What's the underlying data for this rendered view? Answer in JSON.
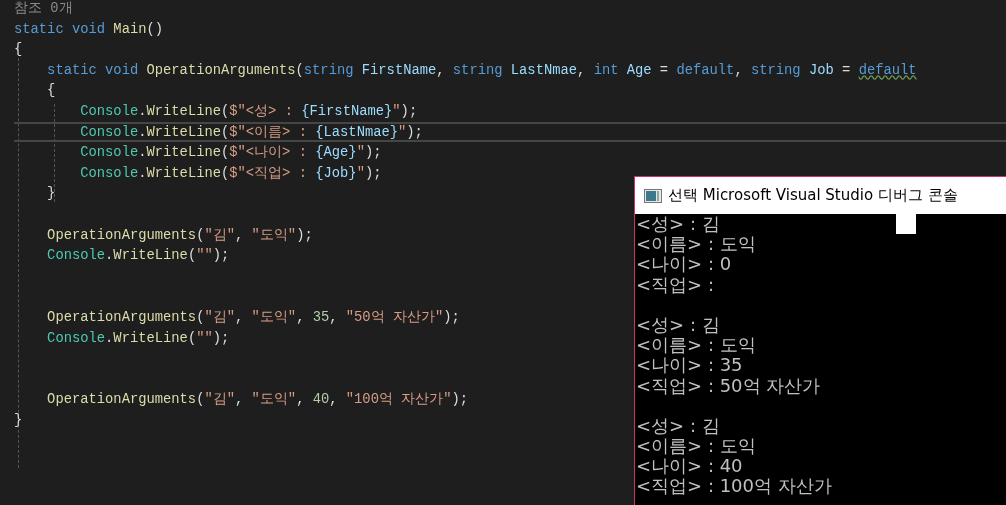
{
  "editor": {
    "lines": [
      {
        "current": false,
        "tokens": [
          {
            "kind": "comment",
            "text": "참조 0개"
          }
        ]
      },
      {
        "current": false,
        "tokens": [
          {
            "kind": "keyword",
            "text": "static void "
          },
          {
            "kind": "method",
            "text": "Main"
          },
          {
            "kind": "plain",
            "text": "()"
          }
        ]
      },
      {
        "current": false,
        "tokens": [
          {
            "kind": "plain",
            "text": "{"
          }
        ]
      },
      {
        "current": false,
        "tokens": [
          {
            "kind": "keyword",
            "text": "    static void "
          },
          {
            "kind": "method",
            "text": "OperationArguments"
          },
          {
            "kind": "plain",
            "text": "("
          },
          {
            "kind": "keyword",
            "text": "string "
          },
          {
            "kind": "param",
            "text": "FirstName"
          },
          {
            "kind": "plain",
            "text": ", "
          },
          {
            "kind": "keyword",
            "text": "string "
          },
          {
            "kind": "param",
            "text": "LastNmae"
          },
          {
            "kind": "plain",
            "text": ", "
          },
          {
            "kind": "keyword",
            "text": "int "
          },
          {
            "kind": "param",
            "text": "Age"
          },
          {
            "kind": "plain",
            "text": " = "
          },
          {
            "kind": "keyword",
            "text": "default"
          },
          {
            "kind": "plain",
            "text": ", "
          },
          {
            "kind": "keyword",
            "text": "string "
          },
          {
            "kind": "param",
            "text": "Job"
          },
          {
            "kind": "plain",
            "text": " = "
          },
          {
            "kind": "keyword",
            "text": "default",
            "squiggle": true
          }
        ]
      },
      {
        "current": false,
        "tokens": [
          {
            "kind": "plain",
            "text": "    {"
          }
        ]
      },
      {
        "current": false,
        "tokens": [
          {
            "kind": "type",
            "text": "        Console"
          },
          {
            "kind": "plain",
            "text": "."
          },
          {
            "kind": "method",
            "text": "WriteLine"
          },
          {
            "kind": "plain",
            "text": "("
          },
          {
            "kind": "string",
            "text": "$\"<성> : "
          },
          {
            "kind": "param",
            "text": "{FirstName}"
          },
          {
            "kind": "string",
            "text": "\""
          },
          {
            "kind": "plain",
            "text": ");"
          }
        ]
      },
      {
        "current": true,
        "tokens": [
          {
            "kind": "type",
            "text": "        Console"
          },
          {
            "kind": "plain",
            "text": "."
          },
          {
            "kind": "method",
            "text": "WriteLine"
          },
          {
            "kind": "plain",
            "text": "("
          },
          {
            "kind": "string",
            "text": "$\"<이름> : "
          },
          {
            "kind": "param",
            "text": "{LastNmae}"
          },
          {
            "kind": "string",
            "text": "\""
          },
          {
            "kind": "plain",
            "text": ");"
          }
        ]
      },
      {
        "current": false,
        "tokens": [
          {
            "kind": "type",
            "text": "        Console"
          },
          {
            "kind": "plain",
            "text": "."
          },
          {
            "kind": "method",
            "text": "WriteLine"
          },
          {
            "kind": "plain",
            "text": "("
          },
          {
            "kind": "string",
            "text": "$\"<나이> : "
          },
          {
            "kind": "param",
            "text": "{Age}"
          },
          {
            "kind": "string",
            "text": "\""
          },
          {
            "kind": "plain",
            "text": ");"
          }
        ]
      },
      {
        "current": false,
        "tokens": [
          {
            "kind": "type",
            "text": "        Console"
          },
          {
            "kind": "plain",
            "text": "."
          },
          {
            "kind": "method",
            "text": "WriteLine"
          },
          {
            "kind": "plain",
            "text": "("
          },
          {
            "kind": "string",
            "text": "$\"<직업> : "
          },
          {
            "kind": "param",
            "text": "{Job}"
          },
          {
            "kind": "string",
            "text": "\""
          },
          {
            "kind": "plain",
            "text": ");"
          }
        ]
      },
      {
        "current": false,
        "tokens": [
          {
            "kind": "plain",
            "text": "    }"
          }
        ]
      },
      {
        "current": false
      },
      {
        "current": false,
        "tokens": [
          {
            "kind": "method",
            "text": "    OperationArguments"
          },
          {
            "kind": "plain",
            "text": "("
          },
          {
            "kind": "string",
            "text": "\"김\""
          },
          {
            "kind": "plain",
            "text": ", "
          },
          {
            "kind": "string",
            "text": "\"도익\""
          },
          {
            "kind": "plain",
            "text": ");"
          }
        ]
      },
      {
        "current": false,
        "tokens": [
          {
            "kind": "type",
            "text": "    Console"
          },
          {
            "kind": "plain",
            "text": "."
          },
          {
            "kind": "method",
            "text": "WriteLine"
          },
          {
            "kind": "plain",
            "text": "("
          },
          {
            "kind": "string",
            "text": "\"\""
          },
          {
            "kind": "plain",
            "text": ");"
          }
        ]
      },
      {
        "current": false
      },
      {
        "current": false
      },
      {
        "current": false,
        "tokens": [
          {
            "kind": "method",
            "text": "    OperationArguments"
          },
          {
            "kind": "plain",
            "text": "("
          },
          {
            "kind": "string",
            "text": "\"김\""
          },
          {
            "kind": "plain",
            "text": ", "
          },
          {
            "kind": "string",
            "text": "\"도익\""
          },
          {
            "kind": "plain",
            "text": ", "
          },
          {
            "kind": "number",
            "text": "35"
          },
          {
            "kind": "plain",
            "text": ", "
          },
          {
            "kind": "string",
            "text": "\"50억 자산가\""
          },
          {
            "kind": "plain",
            "text": ");"
          }
        ]
      },
      {
        "current": false,
        "tokens": [
          {
            "kind": "type",
            "text": "    Console"
          },
          {
            "kind": "plain",
            "text": "."
          },
          {
            "kind": "method",
            "text": "WriteLine"
          },
          {
            "kind": "plain",
            "text": "("
          },
          {
            "kind": "string",
            "text": "\"\""
          },
          {
            "kind": "plain",
            "text": ");"
          }
        ]
      },
      {
        "current": false
      },
      {
        "current": false
      },
      {
        "current": false,
        "tokens": [
          {
            "kind": "method",
            "text": "    OperationArguments"
          },
          {
            "kind": "plain",
            "text": "("
          },
          {
            "kind": "string",
            "text": "\"김\""
          },
          {
            "kind": "plain",
            "text": ", "
          },
          {
            "kind": "string",
            "text": "\"도익\""
          },
          {
            "kind": "plain",
            "text": ", "
          },
          {
            "kind": "number",
            "text": "40"
          },
          {
            "kind": "plain",
            "text": ", "
          },
          {
            "kind": "string",
            "text": "\"100억 자산가\""
          },
          {
            "kind": "plain",
            "text": ");"
          }
        ]
      },
      {
        "current": false,
        "tokens": [
          {
            "kind": "plain",
            "text": "}"
          }
        ]
      }
    ]
  },
  "console": {
    "title": "선택 Microsoft Visual Studio 디버그 콘솔",
    "blocks": [
      [
        "<성> : 김",
        "<이름> : 도익",
        "<나이> : 0",
        "<직업> :"
      ],
      [
        "<성> : 김",
        "<이름> : 도익",
        "<나이> : 35",
        "<직업> : 50억 자산가"
      ],
      [
        "<성> : 김",
        "<이름> : 도익",
        "<나이> : 40",
        "<직업> : 100억 자산가"
      ]
    ]
  }
}
